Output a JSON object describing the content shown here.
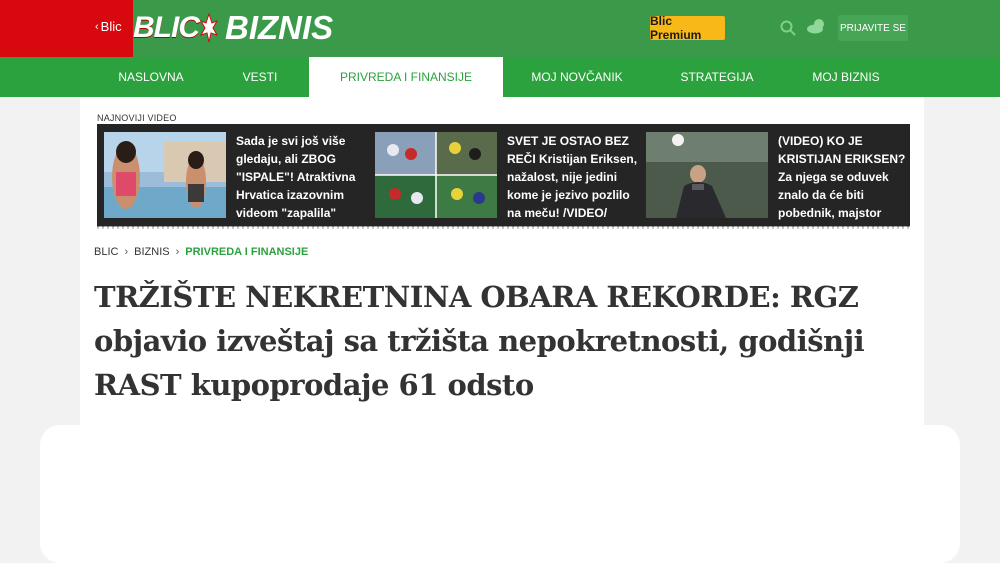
{
  "header": {
    "back_label": "Blic",
    "logo_blic": "BLIC",
    "logo_biznis": "BIZNIS",
    "premium_label": "Blic Premium",
    "login_label": "PRIJAVITE SE",
    "icons": [
      "search-icon",
      "weather-icon",
      "chevron-left-icon"
    ],
    "colors": {
      "green": "#3a9a4a",
      "red": "#d7080e",
      "premium": "#f7b818",
      "nav": "#2ba23d"
    }
  },
  "nav": {
    "items": [
      {
        "label": "NASLOVNA"
      },
      {
        "label": "VESTI"
      },
      {
        "label": "PRIVREDA I FINANSIJE",
        "active": true
      },
      {
        "label": "MOJ NOVČANIK"
      },
      {
        "label": "STRATEGIJA"
      },
      {
        "label": "MOJ BIZNIS"
      }
    ]
  },
  "videos": {
    "section_label": "NAJNOVIJI VIDEO",
    "items": [
      {
        "title": "Sada je svi još više gledaju, ali ZBOG \"ISPALE\"! Atraktivna Hrvatica izazovnim videom \"zapalila\""
      },
      {
        "title": "SVET JE OSTAO BEZ REČI Kristijan Eriksen, nažalost, nije jedini kome je jezivo pozlilo na meču! /VIDEO/"
      },
      {
        "title": "(VIDEO) KO JE KRISTIJAN ERIKSEN? Za njega se oduvek znalo da će biti pobednik, majstor"
      }
    ]
  },
  "breadcrumb": {
    "items": [
      "BLIC",
      "BIZNIS",
      "PRIVREDA I FINANSIJE"
    ]
  },
  "article": {
    "headline": "TRŽIŠTE NEKRETNINA OBARA REKORDE: RGZ objavio izveštaj sa tržišta nepokretnosti, godišnji RAST kupoprodaje 61 odsto"
  }
}
